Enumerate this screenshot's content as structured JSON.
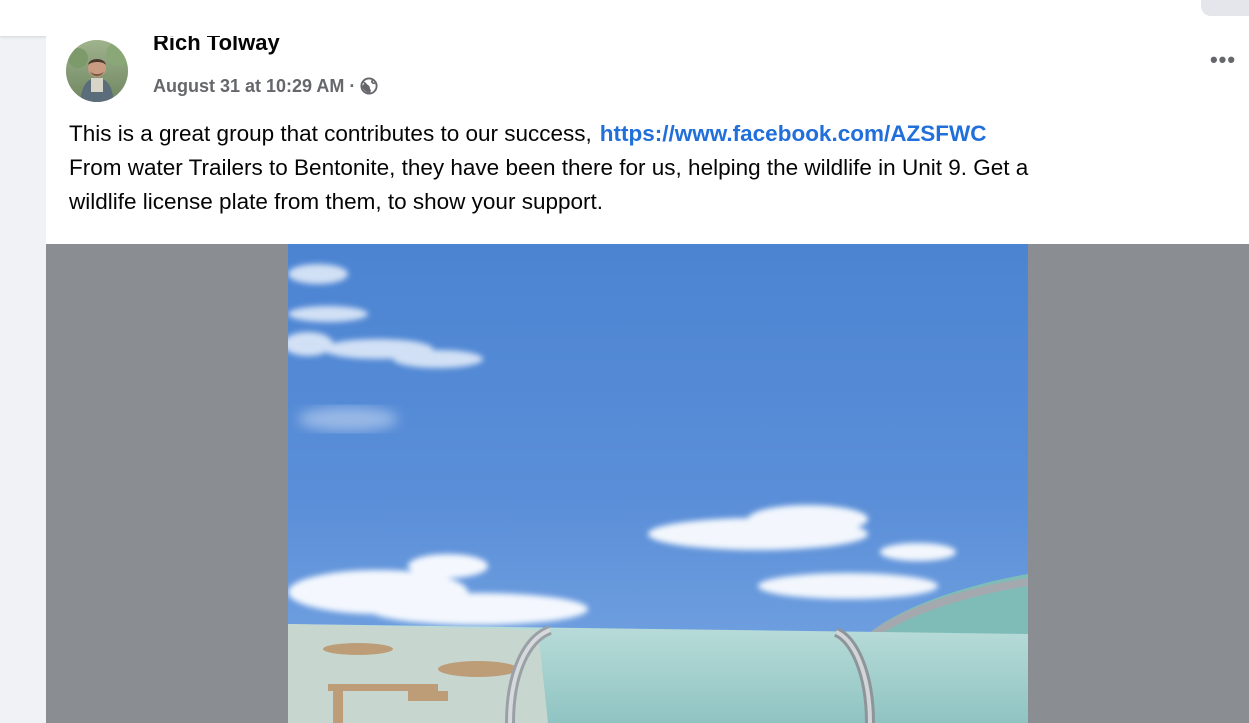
{
  "post": {
    "author": "Rich Tolway",
    "timestamp": "August 31 at 10:29 AM",
    "separator": "·",
    "audience_icon": "globe-icon",
    "more_label": "•••",
    "text_line1": "This is a great group that contributes to our success,",
    "link": "https://www.facebook.com/AZSFWC",
    "text_line2": "From water Trailers to Bentonite, they have been there for us, helping the wildlife in Unit 9.   Get a",
    "text_line3": "wildlife license plate from them, to show your support."
  },
  "colors": {
    "link": "#216fdb",
    "meta_text": "#65676b",
    "media_background": "#8a8d91",
    "sky": "#4f86d4"
  }
}
